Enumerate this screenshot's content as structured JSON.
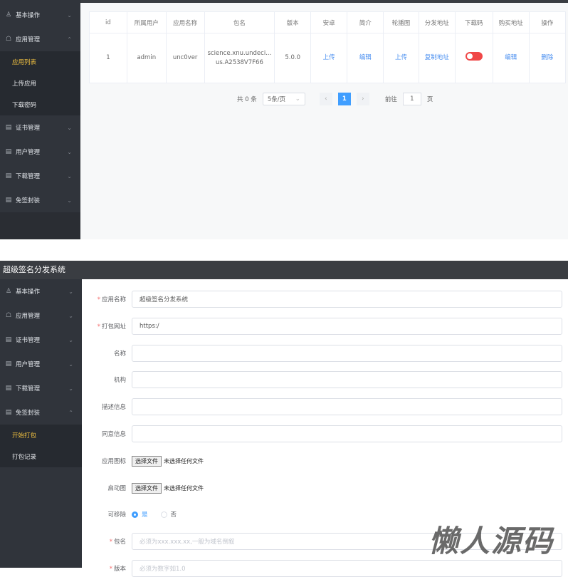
{
  "list_view": {
    "sidebar": [
      {
        "icon": "user-icon",
        "label": "基本操作",
        "chevron": "⌄"
      },
      {
        "icon": "bag-icon",
        "label": "应用管理",
        "chevron": "⌃",
        "children": [
          "应用列表",
          "上传应用",
          "下载密码"
        ],
        "active_child": 0
      },
      {
        "icon": "doc-icon",
        "label": "证书管理",
        "chevron": "⌄"
      },
      {
        "icon": "doc-icon",
        "label": "用户管理",
        "chevron": "⌄"
      },
      {
        "icon": "doc-icon",
        "label": "下载管理",
        "chevron": "⌄"
      },
      {
        "icon": "doc-icon",
        "label": "免签封装",
        "chevron": "⌄"
      }
    ],
    "table": {
      "headers": [
        "id",
        "所属用户",
        "应用名称",
        "包名",
        "版本",
        "安卓",
        "简介",
        "轮播图",
        "分发地址",
        "下载码",
        "购买地址",
        "操作"
      ],
      "rows": [
        {
          "id": "1",
          "user": "admin",
          "app_name": "unc0ver",
          "package": "science.xnu.undeci... us.A2538V7F66",
          "version": "5.0.0",
          "android": "上传",
          "intro": "编辑",
          "carousel": "上传",
          "dist": "复制地址",
          "download_code_on": false,
          "buy": "编辑",
          "action": "删除"
        }
      ]
    },
    "pagination": {
      "total": "共 0 条",
      "page_size": "5条/页",
      "prev": "‹",
      "current": "1",
      "next": "›",
      "goto": "前往",
      "goto_value": "1",
      "page_suffix": "页"
    }
  },
  "form_view": {
    "title": "超级签名分发系统",
    "sidebar": [
      {
        "label": "基本操作",
        "chevron": "⌄"
      },
      {
        "label": "应用管理",
        "chevron": "⌄"
      },
      {
        "label": "证书管理",
        "chevron": "⌄"
      },
      {
        "label": "用户管理",
        "chevron": "⌄"
      },
      {
        "label": "下载管理",
        "chevron": "⌄"
      },
      {
        "label": "免签封装",
        "chevron": "⌃",
        "children": [
          "开始打包",
          "打包记录"
        ],
        "active_child": 0
      }
    ],
    "fields": {
      "app_name": {
        "label": "应用名称",
        "value": "超级签名分发系统"
      },
      "pack_url": {
        "label": "打包网址",
        "value": "https:/"
      },
      "name": {
        "label": "名称",
        "value": ""
      },
      "org": {
        "label": "机构",
        "value": ""
      },
      "desc": {
        "label": "描述信息",
        "value": ""
      },
      "consent": {
        "label": "同意信息",
        "value": ""
      },
      "icon": {
        "label": "应用图标",
        "button": "选择文件",
        "status": "未选择任何文件"
      },
      "splash": {
        "label": "启动图",
        "button": "选择文件",
        "status": "未选择任何文件"
      },
      "removable": {
        "label": "可移除",
        "yes": "是",
        "no": "否",
        "selected": "是"
      },
      "package": {
        "label": "包名",
        "placeholder": "必须为xxx.xxx.xx,一般为域名倒叙"
      },
      "version": {
        "label": "版本",
        "placeholder": "必须为数字如1.0"
      }
    }
  },
  "watermark": "懒人源码"
}
